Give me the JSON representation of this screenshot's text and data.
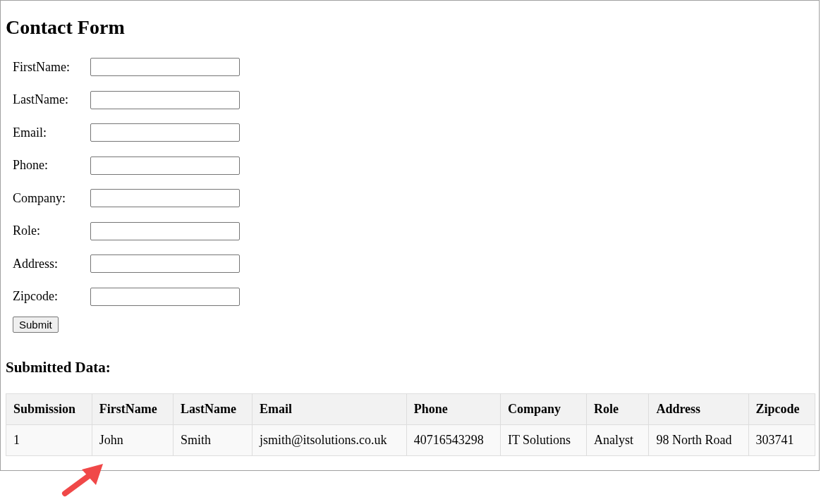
{
  "title": "Contact Form",
  "fields": [
    {
      "label": "FirstName:"
    },
    {
      "label": "LastName:"
    },
    {
      "label": "Email:"
    },
    {
      "label": "Phone:"
    },
    {
      "label": "Company:"
    },
    {
      "label": "Role:"
    },
    {
      "label": "Address:"
    },
    {
      "label": "Zipcode:"
    }
  ],
  "submit_button": "Submit",
  "submitted_heading": "Submitted Data:",
  "table": {
    "columns": [
      "Submission",
      "FirstName",
      "LastName",
      "Email",
      "Phone",
      "Company",
      "Role",
      "Address",
      "Zipcode"
    ],
    "rows": [
      [
        "1",
        "John",
        "Smith",
        "jsmith@itsolutions.co.uk",
        "40716543298",
        "IT Solutions",
        "Analyst",
        "98 North Road",
        "303741"
      ]
    ]
  }
}
